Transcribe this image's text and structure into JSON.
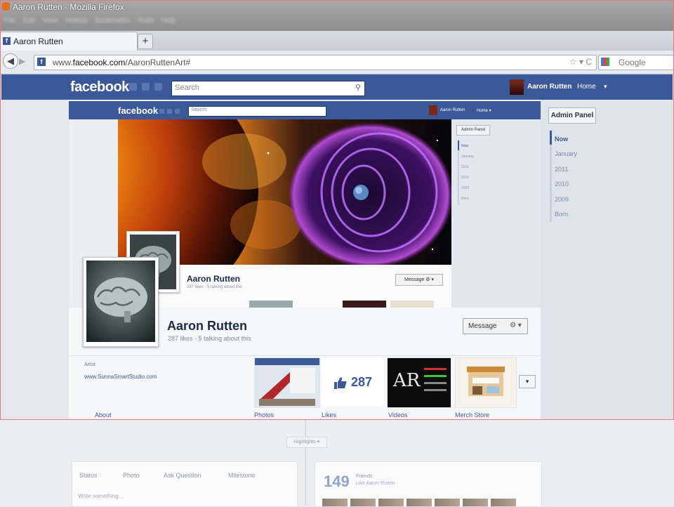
{
  "window": {
    "title": "Aaron Rutten - Mozilla Firefox",
    "menu_blur": "File Edit View History Bookmarks Tools Help"
  },
  "browser": {
    "tab_label": "Aaron Rutten",
    "new_tab": "+",
    "url_prefix": "www.",
    "url_domain": "facebook.com",
    "url_path": "/AaronRuttenArt#",
    "url_controls": "☆ ▾ C",
    "search_placeholder": "Google"
  },
  "facebook_bar": {
    "logo": "facebook",
    "search_placeholder": "Search",
    "user_name": "Aaron Rutten",
    "home": "Home",
    "arrow": "▾"
  },
  "right_panel": {
    "admin_button": "Admin Panel",
    "years": [
      "Now",
      "January",
      "2011",
      "2010",
      "2009",
      "Born"
    ]
  },
  "inner_page": {
    "logo": "facebook",
    "search_placeholder": "Search",
    "user_name": "Aaron Rutten",
    "home": "Home ▾",
    "admin_button": "Admin Panel",
    "years": [
      "Now",
      "January",
      "2011",
      "2010",
      "2009",
      "Born"
    ],
    "name": "Aaron Rutten",
    "subtitle": "287 likes · 5 talking about this",
    "message_button": "Message ⚙ ▾"
  },
  "profile": {
    "name": "Aaron Rutten",
    "subtitle": "287 likes · 5 talking about this",
    "message_button": "Message",
    "gear": "⚙ ▾",
    "about_key": "Artist",
    "about_link": "www.SunnaSmartStudio.com",
    "likes_count": "287",
    "more_button": "▾",
    "tabs": [
      "About",
      "Photos",
      "Likes",
      "Videos",
      "Merch Store"
    ]
  },
  "lower": {
    "timeline_mid": "Highlights ▾",
    "composer_items": [
      "Status",
      "Photo",
      "Ask Question",
      "Milestone"
    ],
    "composer_placeholder": "Write something...",
    "friends_count": "149",
    "friends_label": "Friends",
    "friends_sub": "Like Aaron Rutten"
  },
  "colors": {
    "facebook_blue": "#3b5998",
    "frame_red": "#e67a7a"
  }
}
